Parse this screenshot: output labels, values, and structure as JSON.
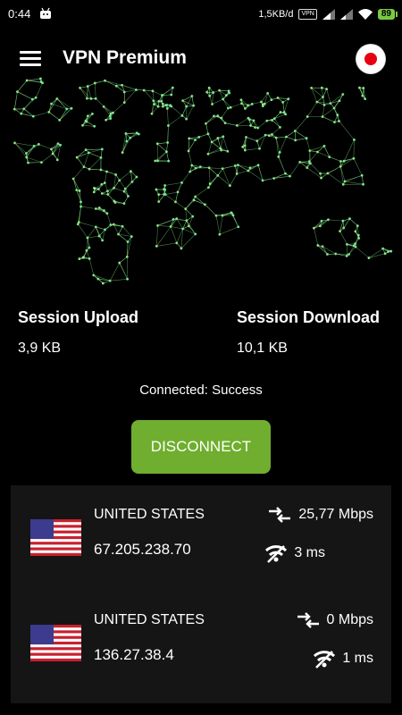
{
  "status_bar": {
    "time": "0:44",
    "speed": "1,5KB/d",
    "vpn_badge": "VPN",
    "battery": "89"
  },
  "header": {
    "title": "VPN Premium",
    "selected_country_flag": "japan-flag-icon"
  },
  "stats": {
    "upload_label": "Session Upload",
    "upload_value": "3,9 KB",
    "download_label": "Session Download",
    "download_value": "10,1 KB"
  },
  "connection": {
    "status": "Connected: Success",
    "button_label": "DISCONNECT",
    "button_color": "#6fae2e"
  },
  "servers": [
    {
      "country": "UNITED STATES",
      "ip": "67.205.238.70",
      "speed": "25,77 Mbps",
      "ping": "3 ms"
    },
    {
      "country": "UNITED STATES",
      "ip": "136.27.38.4",
      "speed": "0 Mbps",
      "ping": "1 ms"
    }
  ],
  "colors": {
    "map_left": "#d8e85a",
    "map_right": "#2fe0b0",
    "list_background": "#151515"
  }
}
